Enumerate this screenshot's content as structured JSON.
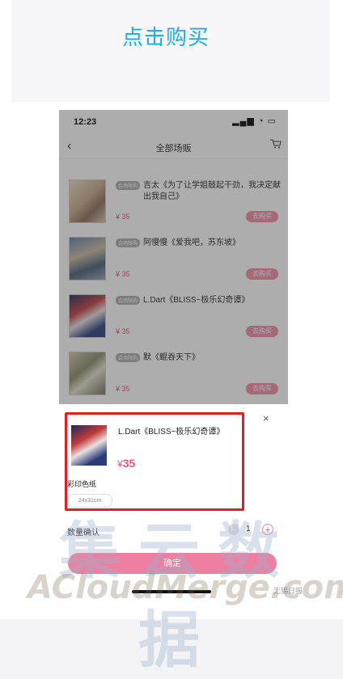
{
  "headline": "点击购买",
  "phone": {
    "status": {
      "time": "12:23",
      "icons": "▂▄▆ ◔ ▭"
    },
    "nav": {
      "back": "‹",
      "title": "全部场贩"
    },
    "badge": "会场限购",
    "items": [
      {
        "title": "吉太《为了让学姐鼓起干劲，我决定献出我自己》",
        "price": "¥ 35",
        "button": "去购买"
      },
      {
        "title": "阿慢慢《爱我吧，苏东坡》",
        "price": "¥ 35",
        "button": "去购买"
      },
      {
        "title": "L.Dart《BLISS~极乐幻奇谭》",
        "price": "¥ 35",
        "button": "去购买"
      },
      {
        "title": "默《鲲吞天下》",
        "price": "¥ 35",
        "button": "去购买"
      }
    ]
  },
  "sheet": {
    "close": "×",
    "title": "L.Dart《BLISS~极乐幻奇谭》",
    "price_symbol": "¥",
    "price": "35",
    "option_label": "彩印色纸",
    "option_chip": "24x31cm",
    "qty_label": "数量确认",
    "qty_minus": "-",
    "qty_value": "1",
    "qty_plus": "+",
    "confirm": "确定"
  },
  "watermark": {
    "cn": "集云数据",
    "en": "ACloudMerge.com",
    "small": "无锡日报"
  },
  "colors": {
    "accent_blue": "#19aee4",
    "pink": "#ee7fa0",
    "price": "#e0547e",
    "highlight": "#e02020"
  }
}
